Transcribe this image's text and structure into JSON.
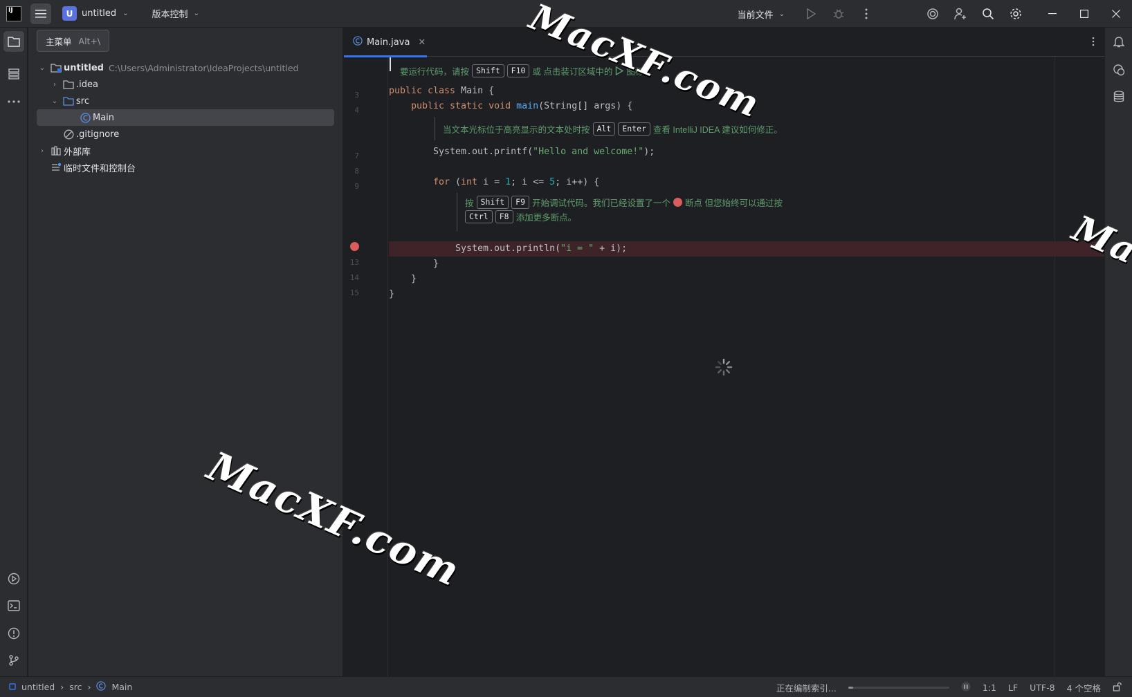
{
  "titlebar": {
    "project_initial": "U",
    "project_name": "untitled",
    "vcs_label": "版本控制",
    "run_config": "当前文件"
  },
  "tooltip": {
    "label": "主菜单",
    "shortcut": "Alt+\\"
  },
  "tree": {
    "root_name": "untitled",
    "root_path": "C:\\Users\\Administrator\\IdeaProjects\\untitled",
    "items": [
      {
        "label": ".idea"
      },
      {
        "label": "src"
      },
      {
        "label": "Main"
      },
      {
        "label": ".gitignore"
      },
      {
        "label": "外部库"
      },
      {
        "label": "临时文件和控制台"
      }
    ]
  },
  "editor": {
    "tab_label": "Main.java",
    "line_numbers": [
      "3",
      "4",
      "7",
      "8",
      "9",
      "13",
      "14",
      "15"
    ],
    "hint1": {
      "prefix": "要运行代码，请按",
      "key1": "Shift",
      "key2": "F10",
      "suffix": "或 点击装订区域中的",
      "suffix2": "图标。"
    },
    "hint2": {
      "prefix": "当文本光标位于高亮显示的文本处时按",
      "key1": "Alt",
      "key2": "Enter",
      "suffix": "查看 IntelliJ IDEA 建议如何修正。"
    },
    "hint3": {
      "prefix": "按",
      "key1": "Shift",
      "key2": "F9",
      "mid": "开始调试代码。我们已经设置了一个",
      "suffix": "断点 但您始终可以通过按",
      "key3": "Ctrl",
      "key4": "F8",
      "suffix2": "添加更多断点。"
    },
    "code": {
      "l3_kw": "public class",
      "l3_rest": " Main {",
      "l4_kw": "public static void",
      "l4_fn": "main",
      "l4_rest": "(String[] args) {",
      "l7_pre": "System.out.printf(",
      "l7_str": "\"Hello and welcome!\"",
      "l7_post": ");",
      "l9_kw": "for",
      "l9_a": " (",
      "l9_kw2": "int",
      "l9_b": " i = ",
      "l9_n1": "1",
      "l9_c": "; i <= ",
      "l9_n2": "5",
      "l9_d": "; i++) {",
      "l12_pre": "System.out.println(",
      "l12_str": "\"i = \"",
      "l12_post": " + i);",
      "l13": "}",
      "l14": "}",
      "l15": "}"
    }
  },
  "statusbar": {
    "crumb1": "untitled",
    "crumb2": "src",
    "crumb3": "Main",
    "indexing": "正在编制索引...",
    "indexing_progress": 0.05,
    "position": "1:1",
    "line_sep": "LF",
    "encoding": "UTF-8",
    "indent": "4 个空格"
  },
  "watermark": {
    "text": "MacXF.com",
    "text_partial": "Ma"
  },
  "colors": {
    "accent": "#3574f0",
    "breakpoint": "#db5c5c",
    "keyword": "#cf8e6d",
    "string": "#6aab73",
    "function": "#56a8f5",
    "number": "#2aacb8"
  }
}
